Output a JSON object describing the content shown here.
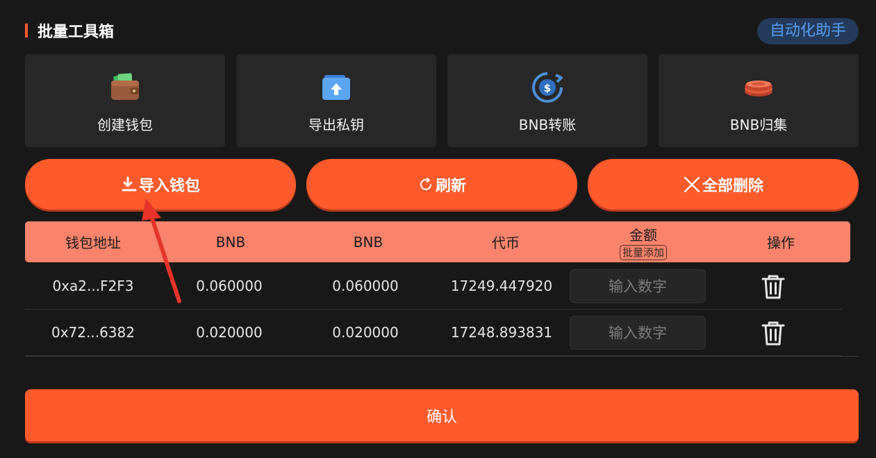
{
  "header": {
    "title": "批量工具箱",
    "auto_label": "自动化助手"
  },
  "tiles": [
    {
      "label": "创建钱包",
      "icon": "wallet-icon"
    },
    {
      "label": "导出私钥",
      "icon": "upload-icon"
    },
    {
      "label": "BNB转账",
      "icon": "coin-transfer-icon"
    },
    {
      "label": "BNB归集",
      "icon": "coin-stack-icon"
    }
  ],
  "actions": [
    {
      "label": "导入钱包",
      "icon": "import-icon"
    },
    {
      "label": "刷新",
      "icon": "refresh-icon"
    },
    {
      "label": "全部删除",
      "icon": "close-icon"
    }
  ],
  "table": {
    "columns": [
      "钱包地址",
      "BNB",
      "BNB",
      "代币",
      "金额",
      "操作"
    ],
    "batch_add": "批量添加",
    "input_placeholder": "输入数字",
    "rows": [
      {
        "address": "0xa2...F2F3",
        "bnb1": "0.060000",
        "bnb2": "0.060000",
        "token": "17249.447920"
      },
      {
        "address": "0x72...6382",
        "bnb1": "0.020000",
        "bnb2": "0.020000",
        "token": "17248.893831"
      }
    ]
  },
  "confirm_label": "确认",
  "colors": {
    "accent": "#ff5a2c",
    "header_row": "#f9836c",
    "auto_button_text": "#5b9cf0"
  }
}
